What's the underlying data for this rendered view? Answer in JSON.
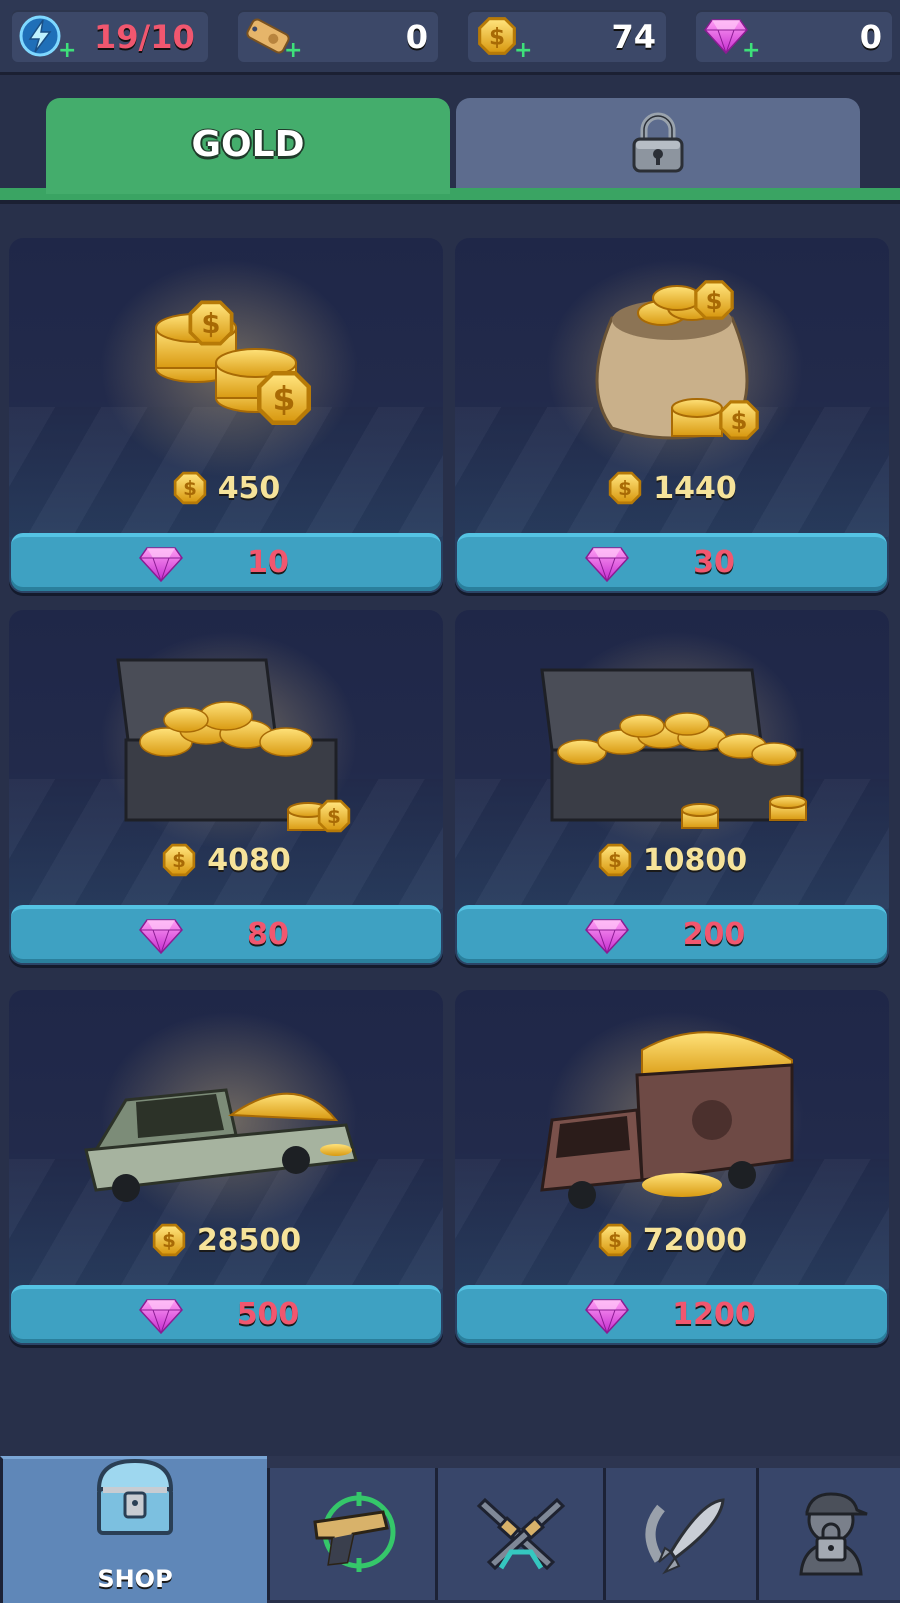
{
  "resources": {
    "energy": {
      "value": "19/10",
      "icon": "energy-icon"
    },
    "tickets": {
      "value": "0",
      "icon": "ticket-icon"
    },
    "gold": {
      "value": "74",
      "icon": "gold-coin-icon"
    },
    "gems": {
      "value": "0",
      "icon": "gem-icon"
    }
  },
  "tabs": {
    "gold_label": "GOLD",
    "locked_icon": "lock-icon"
  },
  "offers": [
    {
      "art": "coin-stacks",
      "gold": "450",
      "price": "10"
    },
    {
      "art": "coin-sack",
      "gold": "1440",
      "price": "30"
    },
    {
      "art": "coin-chest-small",
      "gold": "4080",
      "price": "80"
    },
    {
      "art": "coin-chest-large",
      "gold": "10800",
      "price": "200"
    },
    {
      "art": "pickup-truck-gold",
      "gold": "28500",
      "price": "500"
    },
    {
      "art": "dump-truck-gold",
      "gold": "72000",
      "price": "1200"
    }
  ],
  "nav": {
    "shop_label": "SHOP"
  },
  "colors": {
    "accent_green": "#44ad6c",
    "button_blue": "#3ea1c2",
    "price_red": "#f1576f",
    "gold_text": "#f6e39a"
  }
}
